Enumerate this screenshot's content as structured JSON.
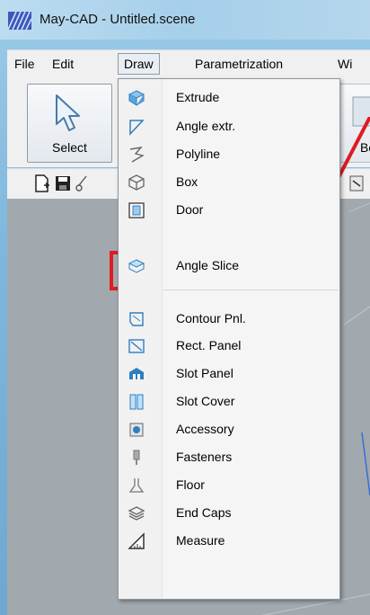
{
  "window": {
    "title": "May-CAD - Untitled.scene"
  },
  "menubar": {
    "items": [
      {
        "label": "File"
      },
      {
        "label": "Edit"
      },
      {
        "label": "Draw"
      },
      {
        "label": "Parametrization"
      },
      {
        "label": "Wi"
      }
    ]
  },
  "toolbar": {
    "select_label": "Select",
    "bo_label": "Bo"
  },
  "draw_menu": {
    "group1": [
      {
        "label": "Extrude",
        "icon": "extrude-icon"
      },
      {
        "label": "Angle extr.",
        "icon": "angle-extrude-icon"
      },
      {
        "label": "Polyline",
        "icon": "polyline-icon"
      },
      {
        "label": "Box",
        "icon": "box-icon"
      },
      {
        "label": "Door",
        "icon": "door-icon"
      },
      {
        "label": "Angle Slice",
        "icon": "angle-slice-icon"
      }
    ],
    "group2": [
      {
        "label": "Contour Pnl.",
        "icon": "contour-panel-icon"
      },
      {
        "label": "Rect. Panel",
        "icon": "rect-panel-icon"
      },
      {
        "label": "Slot Panel",
        "icon": "slot-panel-icon"
      },
      {
        "label": "Slot Cover",
        "icon": "slot-cover-icon"
      },
      {
        "label": "Accessory",
        "icon": "accessory-icon"
      },
      {
        "label": "Fasteners",
        "icon": "fasteners-icon"
      },
      {
        "label": "Floor",
        "icon": "floor-icon"
      },
      {
        "label": "End Caps",
        "icon": "end-caps-icon"
      },
      {
        "label": "Measure",
        "icon": "measure-icon"
      }
    ]
  },
  "colors": {
    "highlight": "#e01a22",
    "accent": "#2f7fbf"
  }
}
